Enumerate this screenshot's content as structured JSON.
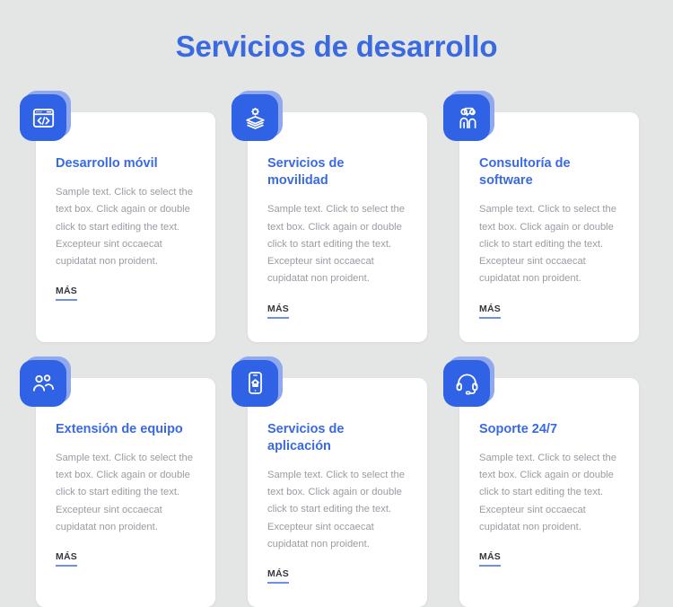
{
  "page": {
    "title": "Servicios de desarrollo",
    "background_color": "#e4e5e5",
    "accent_color": "#3a6ae0",
    "icon_tile_color": "#2f62e4",
    "icon_shadow_color": "#8fa8ef",
    "body_text_color": "#9a9ca3",
    "link_underline_color": "#6f8fe8"
  },
  "cards": [
    {
      "icon": "code-window-icon",
      "title": "Desarrollo móvil",
      "body": "Sample text. Click to select the text box. Click again or double click to start editing the text. Excepteur sint occaecat cupidatat non proident.",
      "link_label": "MÁS"
    },
    {
      "icon": "layers-gear-icon",
      "title": "Servicios de movilidad",
      "body": "Sample text. Click to select the text box. Click again or double click to start editing the text. Excepteur sint occaecat cupidatat non proident.",
      "link_label": "MÁS"
    },
    {
      "icon": "people-consulting-icon",
      "title": "Consultoría de software",
      "body": "Sample text. Click to select the text box. Click again or double click to start editing the text. Excepteur sint occaecat cupidatat non proident.",
      "link_label": "MÁS"
    },
    {
      "icon": "team-group-icon",
      "title": "Extensión de equipo",
      "body": "Sample text. Click to select the text box. Click again or double click to start editing the text. Excepteur sint occaecat cupidatat non proident.",
      "link_label": "MÁS"
    },
    {
      "icon": "mobile-app-icon",
      "title": "Servicios de aplicación",
      "body": "Sample text. Click to select the text box. Click again or double click to start editing the text. Excepteur sint occaecat cupidatat non proident.",
      "link_label": "MÁS"
    },
    {
      "icon": "headset-support-icon",
      "title": "Soporte 24/7",
      "body": "Sample text. Click to select the text box. Click again or double click to start editing the text. Excepteur sint occaecat cupidatat non proident.",
      "link_label": "MÁS"
    }
  ]
}
